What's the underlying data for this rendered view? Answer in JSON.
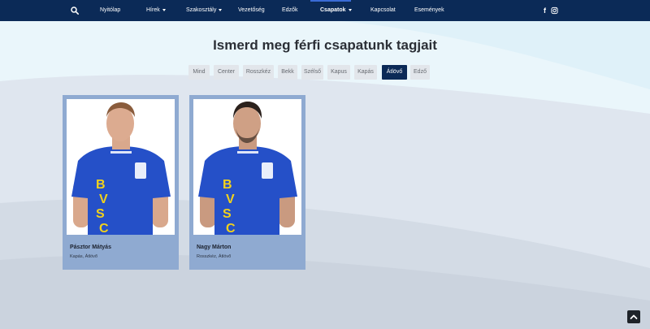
{
  "nav": {
    "items": [
      {
        "label": "Nyitólap",
        "dropdown": false
      },
      {
        "label": "Hírek",
        "dropdown": true
      },
      {
        "label": "Szakosztály",
        "dropdown": true
      },
      {
        "label": "Vezetőség",
        "dropdown": false
      },
      {
        "label": "Edzők",
        "dropdown": false
      },
      {
        "label": "Csapatok",
        "dropdown": true,
        "active": true
      },
      {
        "label": "Kapcsolat",
        "dropdown": false
      },
      {
        "label": "Események",
        "dropdown": false
      }
    ],
    "icons": [
      "search-icon",
      "facebook-icon",
      "instagram-icon"
    ],
    "facebook_glyph": "f",
    "colors": {
      "navbar": "#0b2a57",
      "active_marker": "#3a6bd6"
    }
  },
  "section": {
    "title": "Ismerd meg férfi csapatunk tagjait"
  },
  "filters": {
    "items": [
      "Mind",
      "Center",
      "Rosszkéz",
      "Bekk",
      "Szélső",
      "Kapus",
      "Kapás",
      "Átlövő",
      "Edző"
    ],
    "active": "Átlövő"
  },
  "players": [
    {
      "name": "Pásztor Mátyás",
      "positions": "Kapás, Átlövő",
      "shirt_letters": [
        "B",
        "V",
        "S",
        "C"
      ],
      "jersey_color": "#2550c8"
    },
    {
      "name": "Nagy Márton",
      "positions": "Rosszkéz, Átlövő",
      "shirt_letters": [
        "B",
        "V",
        "S",
        "C"
      ],
      "jersey_color": "#2550c8"
    }
  ],
  "colors": {
    "card": "#8faad1",
    "letters": "#f2d21b",
    "scroll_button": "#1e2329"
  }
}
